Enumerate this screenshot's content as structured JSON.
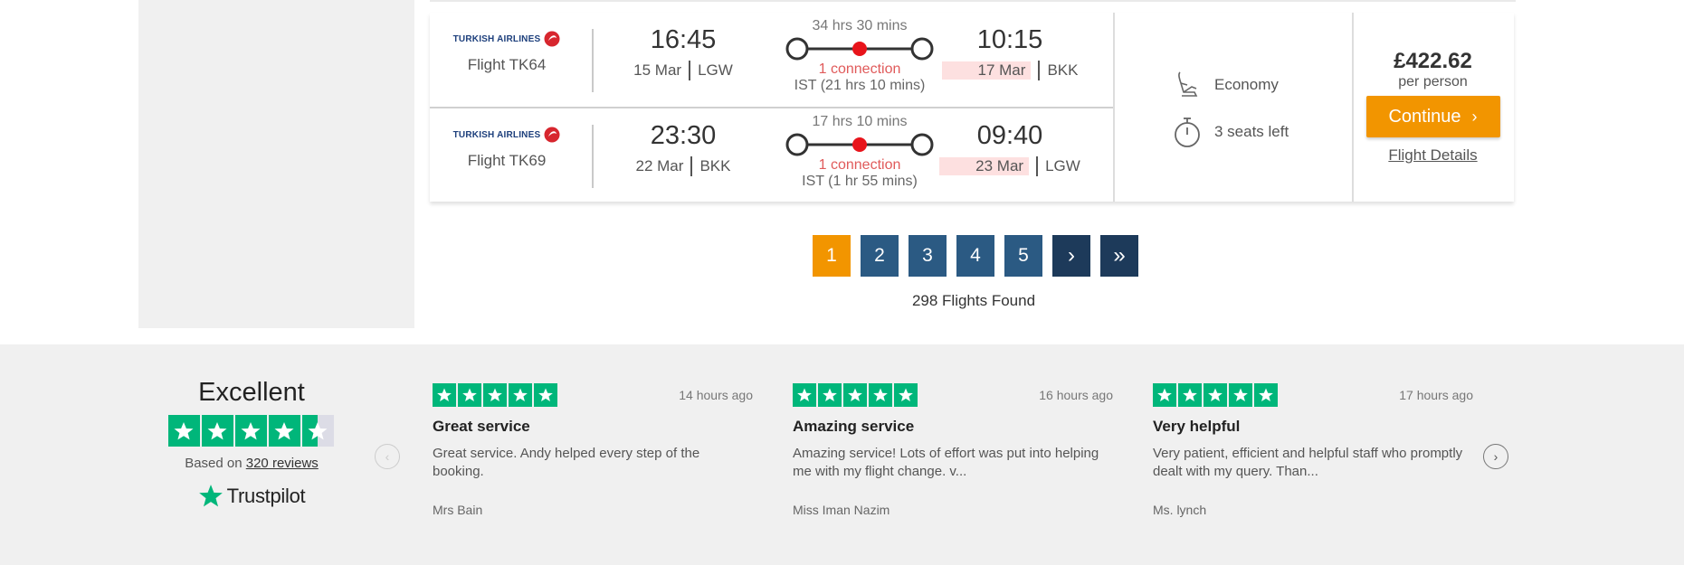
{
  "flights": [
    {
      "airline": "TURKISH AIRLINES",
      "flight_no": "Flight TK64",
      "dep_time": "16:45",
      "dep_date": "15 Mar",
      "dep_airport": "LGW",
      "duration": "34 hrs 30 mins",
      "connection": "1 connection",
      "stopover": "IST (21 hrs 10 mins)",
      "arr_time": "10:15",
      "arr_date": "17 Mar",
      "arr_airport": "BKK"
    },
    {
      "airline": "TURKISH AIRLINES",
      "flight_no": "Flight TK69",
      "dep_time": "23:30",
      "dep_date": "22 Mar",
      "dep_airport": "BKK",
      "duration": "17 hrs 10 mins",
      "connection": "1 connection",
      "stopover": "IST (1 hr 55 mins)",
      "arr_time": "09:40",
      "arr_date": "23 Mar",
      "arr_airport": "LGW"
    }
  ],
  "cabin": {
    "class": "Economy",
    "seats": "3 seats left"
  },
  "price": {
    "amount": "£422.62",
    "per_person": "per person",
    "continue_label": "Continue",
    "details_label": "Flight Details"
  },
  "pagination": {
    "pages": [
      "1",
      "2",
      "3",
      "4",
      "5"
    ],
    "next": "›",
    "last": "»",
    "active": "1"
  },
  "results": {
    "found": "298 Flights Found"
  },
  "trustpilot": {
    "rating_word": "Excellent",
    "based_on_prefix": "Based on",
    "reviews_link": "320 reviews",
    "brand": "Trustpilot"
  },
  "reviews": [
    {
      "ago": "14 hours ago",
      "title": "Great service",
      "body": "Great service. Andy helped every step of the booking.",
      "author": "Mrs Bain"
    },
    {
      "ago": "16 hours ago",
      "title": "Amazing service",
      "body": "Amazing service! Lots of effort was put into helping me with my flight change. v...",
      "author": "Miss Iman Nazim"
    },
    {
      "ago": "17 hours ago",
      "title": "Very helpful",
      "body": "Very patient, efficient and helpful staff who promptly dealt with my query. Than...",
      "author": "Ms. lynch"
    }
  ],
  "colors": {
    "accent": "#f29500",
    "page_btn": "#2b5a83",
    "trustpilot_green": "#00b67a",
    "connection_red": "#e05a5a"
  }
}
